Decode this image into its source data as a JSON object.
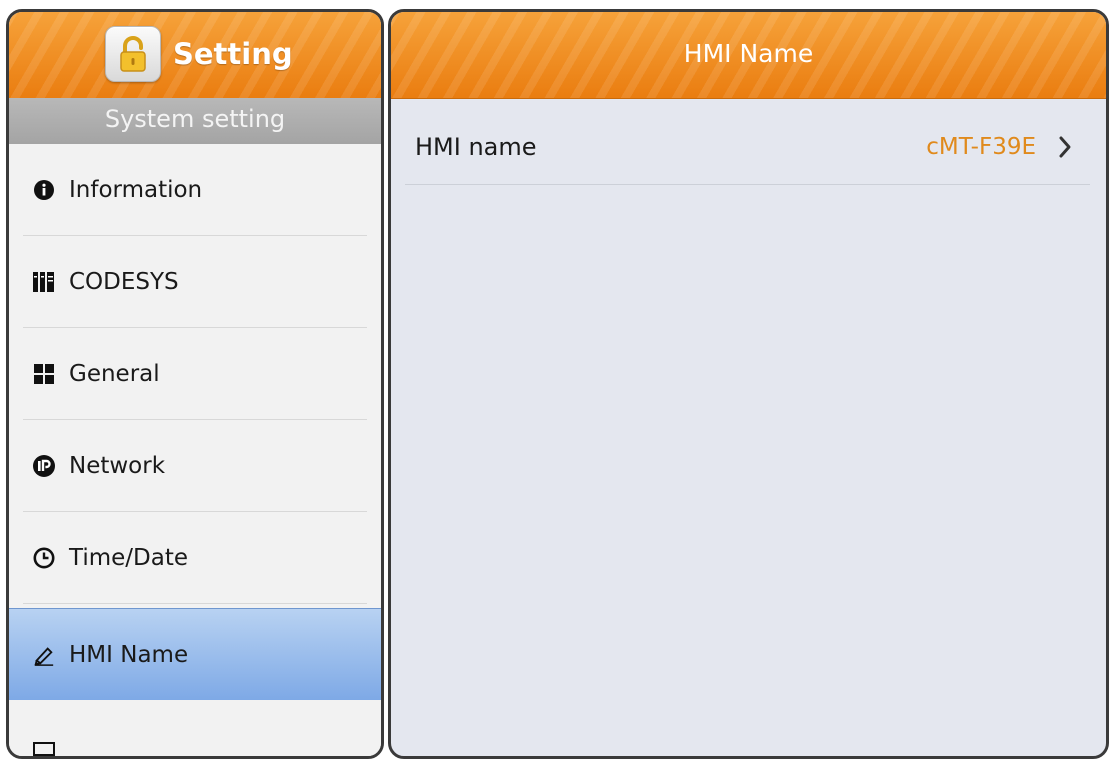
{
  "sidebar": {
    "title": "Setting",
    "lock_icon": "unlocked-padlock-icon",
    "section_header": "System setting",
    "items": [
      {
        "label": "Information",
        "icon": "info-circle-icon"
      },
      {
        "label": "CODESYS",
        "icon": "library-books-icon"
      },
      {
        "label": "General",
        "icon": "grid-squares-icon"
      },
      {
        "label": "Network",
        "icon": "ip-circle-icon"
      },
      {
        "label": "Time/Date",
        "icon": "clock-icon"
      },
      {
        "label": "HMI Name",
        "icon": "pencil-icon",
        "selected": true
      },
      {
        "label": "",
        "icon": "screen-icon"
      }
    ]
  },
  "main": {
    "title": "HMI Name",
    "rows": [
      {
        "label": "HMI name",
        "value": "cMT-F39E",
        "icon": "chevron-right-icon"
      }
    ]
  },
  "colors": {
    "header_orange": "#ea7d10",
    "value_orange": "#e08a1c",
    "selected_blue": "#7ea9e6",
    "section_gray": "#a4a4a4"
  }
}
